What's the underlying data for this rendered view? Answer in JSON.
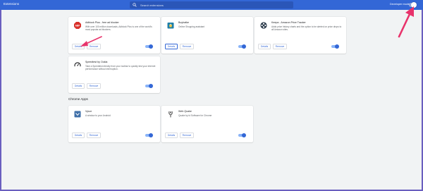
{
  "app": {
    "title": "Extensions"
  },
  "search": {
    "placeholder": "Search extensions"
  },
  "header": {
    "developer_mode_label": "Developer mode",
    "developer_mode_on": false
  },
  "extensions": [
    {
      "name": "Adblock Plus - free ad blocker",
      "description": "With over 100 million downloads, Adblock Plus is one of the world's most popular ad blockers.",
      "details_label": "Details",
      "remove_label": "Remove",
      "enabled": true
    },
    {
      "name": "Buyhatke",
      "description": "Online Shopping assistant",
      "details_label": "Details",
      "remove_label": "Remove",
      "enabled": true
    },
    {
      "name": "Keepa - Amazon Price Tracker",
      "description": "Adds price history charts and the option to be alerted on price drops to all Amazon sites.",
      "details_label": "Details",
      "remove_label": "Remove",
      "enabled": true
    },
    {
      "name": "Speedtest by Ookla",
      "description": "Take a Speedtest directly from your toolbar to quickly test your internet performance without interruption.",
      "details_label": "Details",
      "remove_label": "Remove",
      "enabled": true
    }
  ],
  "chrome_apps": {
    "title": "Chrome Apps",
    "items": [
      {
        "name": "Vysor",
        "description": "A window to your Android",
        "details_label": "Details",
        "remove_label": "Remove",
        "enabled": true
      },
      {
        "name": "Web Quake",
        "description": "Quake by id Software for Chrome",
        "details_label": "Details",
        "remove_label": "Remove",
        "enabled": true
      }
    ]
  },
  "colors": {
    "header": "#3367d6",
    "accent": "#3367d6",
    "annotation_arrow": "#e8336b",
    "background": "#f1f3f4"
  }
}
